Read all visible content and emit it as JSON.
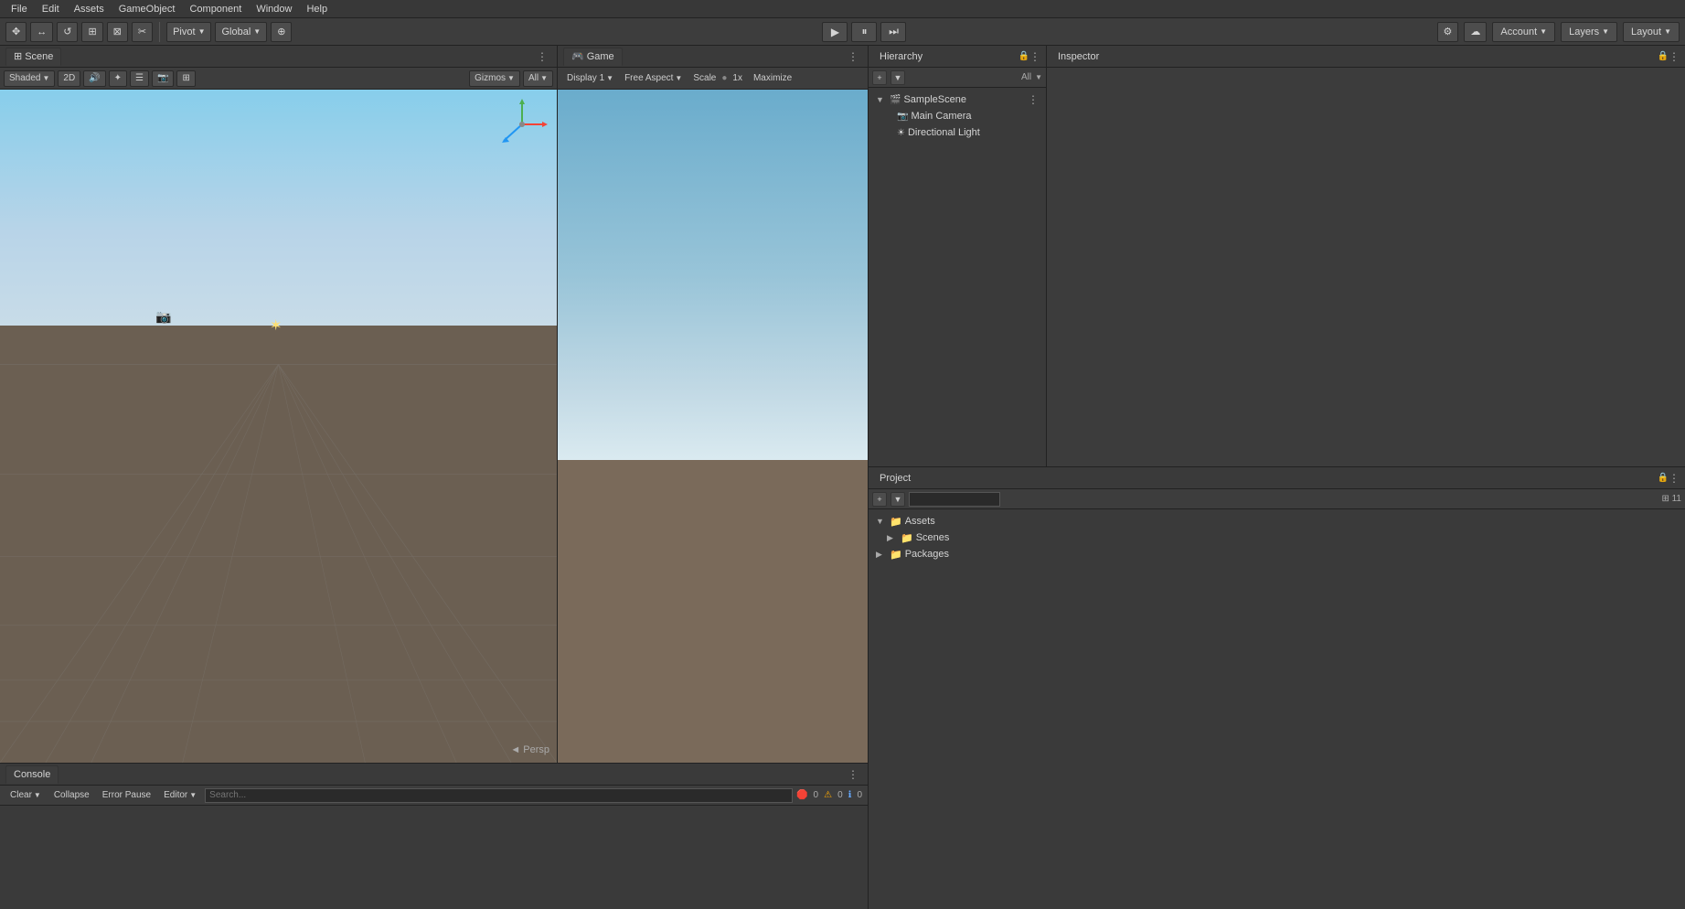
{
  "menu": {
    "items": [
      "File",
      "Edit",
      "Assets",
      "GameObject",
      "Component",
      "Window",
      "Help"
    ]
  },
  "toolbar": {
    "tools": [
      "✥",
      "↔",
      "↺",
      "⊞",
      "⊠",
      "✂"
    ],
    "pivot_label": "Pivot",
    "global_label": "Global",
    "play_icon": "▶",
    "pause_icon": "⏸",
    "step_icon": "⏭",
    "account_label": "Account",
    "layers_label": "Layers",
    "layout_label": "Layout",
    "cloud_icon": "☁",
    "settings_icon": "⚙"
  },
  "scene": {
    "tab_label": "Scene",
    "shading_mode": "Shaded",
    "toggle_2d": "2D",
    "gizmos_label": "Gizmos",
    "all_label": "All",
    "persp_label": "◄ Persp"
  },
  "game": {
    "tab_label": "Game",
    "display_label": "Display 1",
    "aspect_label": "Free Aspect",
    "scale_label": "Scale",
    "scale_value": "1x",
    "maximize_label": "Maximize"
  },
  "console": {
    "tab_label": "Console",
    "clear_label": "Clear",
    "collapse_label": "Collapse",
    "error_pause_label": "Error Pause",
    "editor_label": "Editor",
    "error_count": "0",
    "warning_count": "0",
    "info_count": "0"
  },
  "hierarchy": {
    "tab_label": "Hierarchy",
    "all_label": "All",
    "scene_name": "SampleScene",
    "items": [
      {
        "label": "Main Camera",
        "icon": "📷",
        "indent": 1
      },
      {
        "label": "Directional Light",
        "icon": "☀",
        "indent": 1
      }
    ]
  },
  "inspector": {
    "tab_label": "Inspector"
  },
  "project": {
    "tab_label": "Project",
    "assets_label": "Assets",
    "scenes_label": "Scenes",
    "packages_label": "Packages",
    "count": "11"
  }
}
